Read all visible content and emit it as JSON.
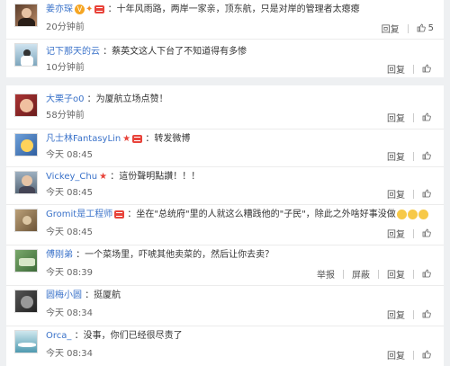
{
  "actions": {
    "reply": "回复",
    "report": "举报",
    "block": "屏蔽"
  },
  "comments": [
    {
      "user": "姜亦琛",
      "badges": [
        "vip",
        "fire",
        "member"
      ],
      "text": "：十年风雨路，两岸一家亲，顶东航，只是对岸的管理者太瘪瘪",
      "time": "20分钟前",
      "likes": "5"
    },
    {
      "user": "记下那天的云",
      "badges": [],
      "text": "：蔡英文这人下台了不知道得有多惨",
      "time": "10分钟前",
      "likes": ""
    },
    {
      "user": "大栗子o0",
      "badges": [],
      "text": "：为厦航立场点赞！",
      "time": "58分钟前",
      "likes": ""
    },
    {
      "user": "凡士林FantasyLin",
      "badges": [
        "star",
        "member"
      ],
      "text": "：转发微博",
      "time": "今天 08:45",
      "likes": ""
    },
    {
      "user": "Vickey_Chu",
      "badges": [
        "star"
      ],
      "text": "：這份聲明點讚！！！",
      "time": "今天 08:45",
      "likes": ""
    },
    {
      "user": "Gromit是工程师",
      "badges": [
        "member"
      ],
      "text": "：坐在\"总统府\"里的人就这么糟践他的\"子民\"，除此之外啥好事没做",
      "time": "今天 08:45",
      "likes": ""
    },
    {
      "user": "傅刚弟",
      "badges": [],
      "text": "：一个菜场里，吓唬其他卖菜的，然后让你去卖？",
      "time": "今天 08:39",
      "likes": ""
    },
    {
      "user": "圆梅小圆",
      "badges": [],
      "text": "：挺厦航",
      "time": "今天 08:34",
      "likes": ""
    },
    {
      "user": "Orca_",
      "badges": [],
      "text": "：没事，你们已经很尽责了",
      "time": "今天 08:34",
      "likes": ""
    }
  ]
}
